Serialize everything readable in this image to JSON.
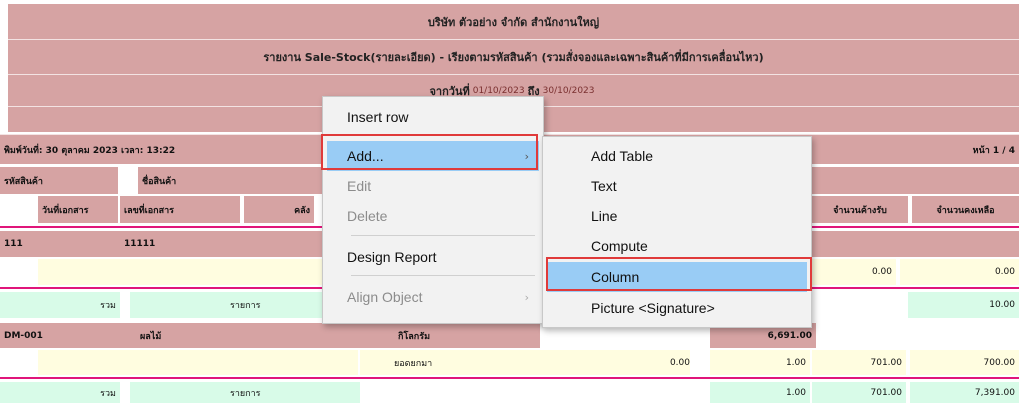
{
  "report": {
    "company_line": "บริษัท ตัวอย่าง จำกัด   สำนักงานใหญ่",
    "title_line": "รายงาน Sale-Stock(รายละเอียด) - เรียงตามรหัสสินค้า (รวมสั่งจองและเฉพาะสินค้าที่มีการเคลื่อนไหว)",
    "date_prefix": "จากวันที่",
    "date_from": "01/10/2023",
    "date_mid": "ถึง",
    "date_to": "30/10/2023",
    "printed_text": "พิมพ์วันที่: 30 ตุลาคม 2023  เวลา: 13:22",
    "page_text": "หน้า 1 / 4",
    "col_product_code": "รหัสสินค้า",
    "col_product_name": "ชื่อสินค้า",
    "col_doc_date": "วันที่เอกสาร",
    "col_doc_no": "เลขที่เอกสาร",
    "col_warehouse": "คลัง",
    "col_pending_receive": "จำนวนค้างรับ",
    "col_balance": "จำนวนคงเหลือ",
    "group1_code": "111",
    "group1_name": "11111",
    "group1_row_v1": "0.00",
    "group1_row_v2": "0.00",
    "sum_label": "รวม",
    "items_label": "รายการ",
    "group1_sum_balance": "10.00",
    "group2_code": "DM-001",
    "group2_name": "ผลไม้",
    "group2_unit": "กิโลกรัม",
    "group2_qty": "6,691.00",
    "carry_label": "ยอดยกมา",
    "carry_v1": "0.00",
    "carry_v2": "1.00",
    "carry_v3": "701.00",
    "carry_v4": "700.00",
    "sum2_v1": "1.00",
    "sum2_v2": "701.00",
    "sum2_v3": "7,391.00"
  },
  "context_menu": {
    "items": [
      {
        "label": "Insert row",
        "enabled": true
      },
      {
        "label": "Add...",
        "enabled": true,
        "highlighted": true,
        "has_submenu": true
      },
      {
        "label": "Edit",
        "enabled": false
      },
      {
        "label": "Delete",
        "enabled": false
      },
      {
        "label": "Design Report",
        "enabled": true
      },
      {
        "label": "Align Object",
        "enabled": false,
        "has_submenu": true
      }
    ],
    "submenu_arrow": "›"
  },
  "submenu": {
    "items": [
      {
        "label": "Add Table"
      },
      {
        "label": "Text"
      },
      {
        "label": "Line"
      },
      {
        "label": "Compute"
      },
      {
        "label": "Column",
        "highlighted": true
      },
      {
        "label": "Picture <Signature>"
      }
    ]
  },
  "colors": {
    "header_bg": "#d6a3a3",
    "row_cream": "#fffde0",
    "row_mint": "#d8fbe8",
    "separator_pink": "#e0157a",
    "highlight": "#99ccf5",
    "callout_red": "#e03a3a"
  }
}
